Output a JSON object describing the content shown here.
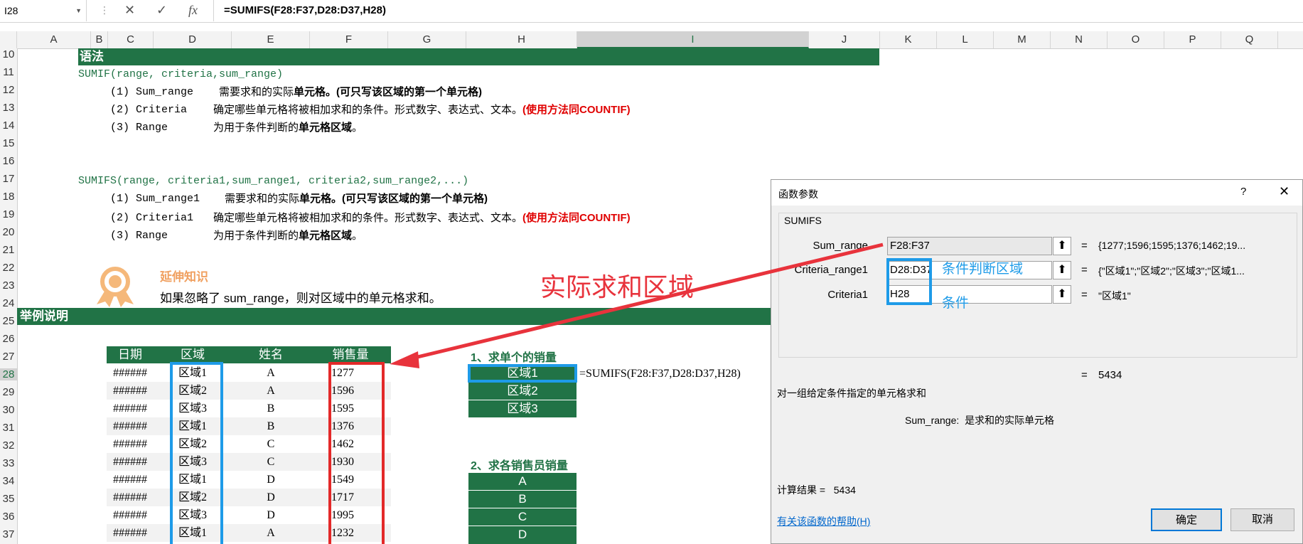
{
  "formula_bar": {
    "name_box": "I28",
    "cancel_icon": "✕",
    "enter_icon": "✓",
    "fx_icon": "fx",
    "formula": "=SUMIFS(F28:F37,D28:D37,H28)"
  },
  "columns": [
    "A",
    "B",
    "C",
    "D",
    "E",
    "F",
    "G",
    "H",
    "I",
    "J",
    "K",
    "L",
    "M",
    "N",
    "O",
    "P",
    "Q"
  ],
  "rows": [
    "10",
    "11",
    "12",
    "13",
    "14",
    "15",
    "16",
    "17",
    "18",
    "19",
    "20",
    "21",
    "22",
    "23",
    "24",
    "25",
    "26",
    "27",
    "28",
    "29",
    "30",
    "31",
    "32",
    "33",
    "34",
    "35",
    "36",
    "37"
  ],
  "syntax": {
    "header": "语法",
    "sumif": "SUMIF(range, criteria,sum_range)",
    "sumif_args": [
      {
        "label": "(1) Sum_range",
        "desc": "需要求和的实际",
        "bold": "单元格",
        "desc2": "。(可只写该区域的第一个单元格)"
      },
      {
        "label": "(2) Criteria",
        "desc": "确定哪些单元格将被相加求和的条件。形式数字、表达式、文本。",
        "red": "(使用方法同COUNTIF)"
      },
      {
        "label": "(3) Range",
        "desc": "为用于条件判断的",
        "bold": "单元格区域",
        "desc2": "。"
      }
    ],
    "sumifs": "SUMIFS(range, criteria1,sum_range1, criteria2,sum_range2,...)",
    "sumifs_args": [
      {
        "label": "(1) Sum_range1",
        "desc": "需要求和的实际",
        "bold": "单元格",
        "desc2": "。(可只写该区域的第一个单元格)"
      },
      {
        "label": "(2) Criteria1",
        "desc": "确定哪些单元格将被相加求和的条件。形式数字、表达式、文本。",
        "red": "(使用方法同COUNTIF)"
      },
      {
        "label": "(3) Range",
        "desc": "为用于条件判断的",
        "bold": "单元格区域",
        "desc2": "。"
      }
    ]
  },
  "tip": {
    "title": "延伸知识",
    "text": "如果忽略了 sum_range，则对区域中的单元格求和。"
  },
  "annotation_big": "实际求和区域",
  "annotation_criteria_range": "条件判断区域",
  "annotation_criteria": "条件",
  "example": {
    "header": "举例说明",
    "table_headers": [
      "日期",
      "区域",
      "姓名",
      "销售量"
    ],
    "rows": [
      [
        "######",
        "区域1",
        "A",
        "1277"
      ],
      [
        "######",
        "区域2",
        "A",
        "1596"
      ],
      [
        "######",
        "区域3",
        "B",
        "1595"
      ],
      [
        "######",
        "区域1",
        "B",
        "1376"
      ],
      [
        "######",
        "区域2",
        "C",
        "1462"
      ],
      [
        "######",
        "区域3",
        "C",
        "1930"
      ],
      [
        "######",
        "区域1",
        "D",
        "1549"
      ],
      [
        "######",
        "区域2",
        "D",
        "1717"
      ],
      [
        "######",
        "区域3",
        "D",
        "1995"
      ],
      [
        "######",
        "区域1",
        "A",
        "1232"
      ]
    ],
    "q1_title": "1、求单个的销量",
    "q1_items": [
      "区域1",
      "区域2",
      "区域3"
    ],
    "q1_formula": "=SUMIFS(F28:F37,D28:D37,H28)",
    "q2_title": "2、求各销售员销量",
    "q2_items": [
      "A",
      "B",
      "C",
      "D"
    ]
  },
  "dialog": {
    "title": "函数参数",
    "help_icon": "?",
    "close_icon": "✕",
    "func_name": "SUMIFS",
    "args": [
      {
        "label": "Sum_range",
        "value": "F28:F37",
        "result": "{1277;1596;1595;1376;1462;19..."
      },
      {
        "label": "Criteria_range1",
        "value": "D28:D37",
        "result": "{\"区域1\";\"区域2\";\"区域3\";\"区域1..."
      },
      {
        "label": "Criteria1",
        "value": "H28",
        "result": "\"区域1\""
      }
    ],
    "equals": "=",
    "total": "5434",
    "description": "对一组给定条件指定的单元格求和",
    "arg_help_label": "Sum_range:",
    "arg_help_text": "是求和的实际单元格",
    "calc_result_label": "计算结果 =",
    "calc_result_value": "5434",
    "help_link": "有关该函数的帮助(H)",
    "ok_label": "确定",
    "cancel_label": "取消"
  },
  "colors": {
    "excel_green": "#217346",
    "highlight_red": "#e32929",
    "highlight_blue": "#1e9be8",
    "annotation_red": "#e8333c"
  }
}
